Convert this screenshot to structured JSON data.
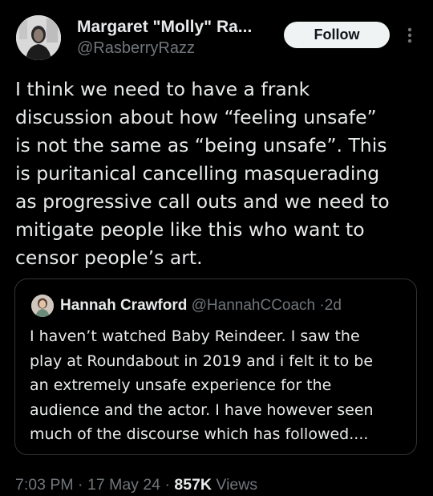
{
  "author": {
    "display_name": "Margaret \"Molly\" Ra...",
    "handle": "@RasberryRazz"
  },
  "actions": {
    "follow_label": "Follow",
    "more_icon": "more-vertical-icon"
  },
  "tweet": {
    "text": "I think we need to have a frank\ndiscussion about how “feeling unsafe”\nis not the same as “being unsafe”. This\nis puritanical cancelling masquerading\nas progressive call outs and we need to\nmitigate people like this who want to\ncensor people’s art."
  },
  "quote": {
    "display_name": "Hannah Crawford",
    "handle": "@HannahCCoach",
    "separator": "·",
    "time": "2d",
    "text": "I haven’t watched Baby Reindeer. I saw the\nplay at Roundabout in 2019 and i felt it to be\nan extremely unsafe experience for the\naudience and the actor. I have however seen\nmuch of the discourse which has followed...."
  },
  "meta": {
    "time": "7:03 PM",
    "sep1": "·",
    "date": "17 May 24",
    "sep2": "·",
    "views_count": "857K",
    "views_label": "Views"
  },
  "colors": {
    "background": "#000000",
    "primary_text": "#e7e9ea",
    "secondary_text": "#71767b",
    "border": "#2f3336",
    "follow_button_bg": "#eff3f4",
    "follow_button_text": "#0f1419"
  }
}
